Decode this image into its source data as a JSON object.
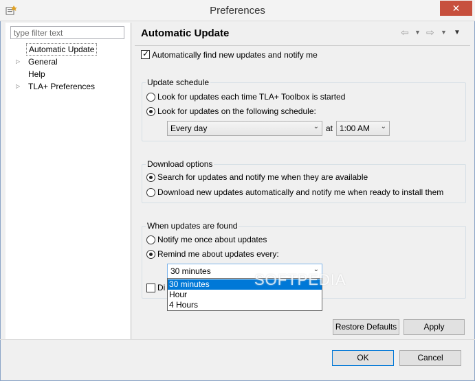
{
  "window": {
    "title": "Preferences",
    "close_label": "✕"
  },
  "filter": {
    "placeholder": "type filter text"
  },
  "tree": {
    "items": [
      {
        "label": "Automatic Update",
        "selected": true,
        "expandable": false
      },
      {
        "label": "General",
        "expandable": true
      },
      {
        "label": "Help",
        "expandable": false
      },
      {
        "label": "TLA+ Preferences",
        "expandable": true
      }
    ],
    "arrow_glyph": "▷"
  },
  "page": {
    "title": "Automatic Update",
    "nav": {
      "back": "⇦",
      "forward": "⇨",
      "menu": "▼"
    }
  },
  "auto_find": {
    "label": "Automatically find new updates and notify me",
    "checked": true
  },
  "schedule": {
    "title": "Update schedule",
    "options": [
      "Look for updates each time TLA+ Toolbox is started",
      "Look for updates on the following schedule:"
    ],
    "selected_index": 1,
    "day_value": "Every day",
    "at_label": "at",
    "time_value": "1:00 AM"
  },
  "download": {
    "title": "Download options",
    "options": [
      "Search for updates and notify me when they are available",
      "Download new updates automatically and notify me when ready to install them"
    ],
    "selected_index": 0
  },
  "found": {
    "title": "When updates are found",
    "options": [
      "Notify me once about updates",
      "Remind me about updates every:"
    ],
    "selected_index": 1,
    "remind_value": "30 minutes",
    "remind_options": [
      "30 minutes",
      "Hour",
      "4 Hours"
    ],
    "hidden_checkbox_label": "Di"
  },
  "buttons": {
    "restore_defaults": "Restore Defaults",
    "apply": "Apply",
    "ok": "OK",
    "cancel": "Cancel"
  },
  "watermark": "SOFTPEDIA",
  "colors": {
    "selection": "#0078d7",
    "close_button": "#c7503e",
    "focus_border": "#7eb4ea"
  }
}
